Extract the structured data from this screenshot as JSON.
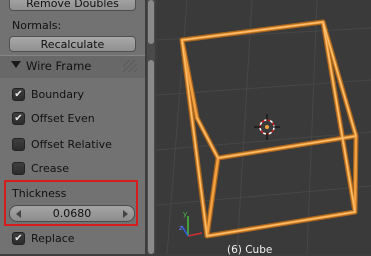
{
  "panel": {
    "remove_doubles_label": "Remove Doubles",
    "normals_label": "Normals:",
    "recalculate_label": "Recalculate",
    "wireframe_section": {
      "title": "Wire Frame",
      "expanded": true
    },
    "options": [
      {
        "label": "Boundary",
        "checked": true
      },
      {
        "label": "Offset Even",
        "checked": true
      },
      {
        "label": "Offset Relative",
        "checked": false
      },
      {
        "label": "Crease",
        "checked": false
      }
    ],
    "thickness_label": "Thickness",
    "thickness_value": "0.0680",
    "replace": {
      "label": "Replace",
      "checked": true
    }
  },
  "viewport": {
    "object_label": "(6) Cube",
    "wire_color": "#f2a040",
    "grid_color": "#474747"
  }
}
